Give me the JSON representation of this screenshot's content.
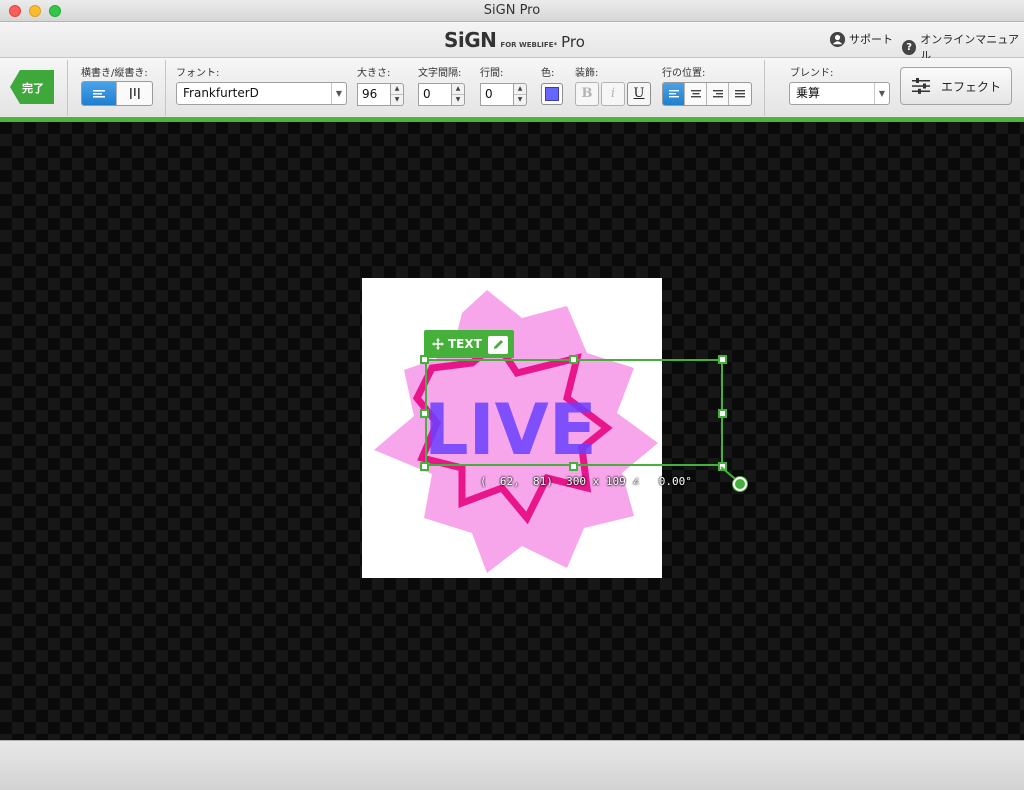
{
  "window": {
    "title": "SiGN Pro"
  },
  "brand": {
    "name": "SiGN",
    "sub": "FOR WEBLIFE*",
    "edition": "Pro"
  },
  "header_links": {
    "support": "サポート",
    "manual": "オンラインマニュアル"
  },
  "toolbar": {
    "done_label": "完了",
    "orientation_label": "横書き/縦書き:",
    "font_label": "フォント:",
    "font_value": "FrankfurterD",
    "size_label": "大きさ:",
    "size_value": "96",
    "letter_spacing_label": "文字間隔:",
    "letter_spacing_value": "0",
    "line_spacing_label": "行間:",
    "line_spacing_value": "0",
    "color_label": "色:",
    "text_color": "#6666ff",
    "decoration_label": "装飾:",
    "bold_label": "B",
    "italic_label": "i",
    "underline_label": "U",
    "align_label": "行の位置:",
    "blend_label": "ブレンド:",
    "blend_value": "乗算",
    "effect_label": "エフェクト"
  },
  "canvas": {
    "selection_tag": "TEXT",
    "artwork_text": "LIVE",
    "coord_readout": "(  62,  81)  300 x 109 ∠   0.00°"
  },
  "colors": {
    "accent_green": "#45b03a",
    "star_outline": "#e8168a",
    "star_fill": "#f7a6ec",
    "text_purple": "#6a40ff"
  }
}
